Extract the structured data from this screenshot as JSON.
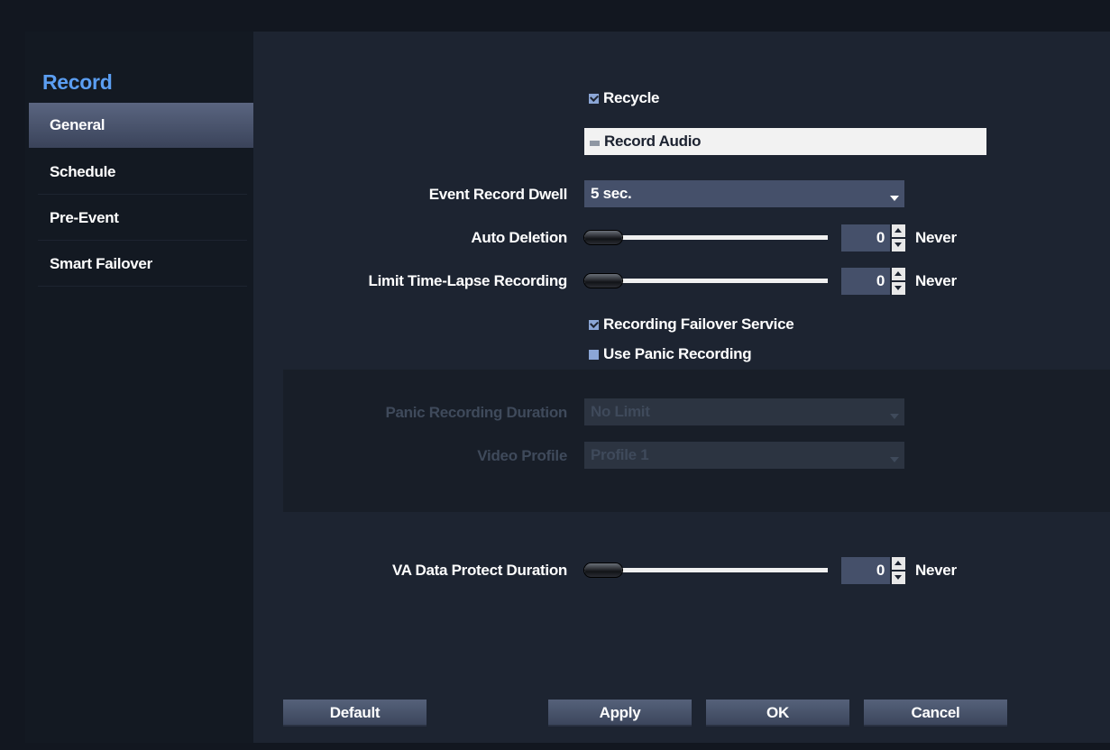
{
  "sidebar": {
    "title": "Record",
    "items": [
      {
        "label": "General"
      },
      {
        "label": "Schedule"
      },
      {
        "label": "Pre-Event"
      },
      {
        "label": "Smart Failover"
      }
    ]
  },
  "general": {
    "recycle": {
      "label": "Recycle",
      "checked": true
    },
    "record_audio": {
      "label": "Record Audio",
      "checked": false
    },
    "event_record_dwell": {
      "label": "Event Record Dwell",
      "value": "5 sec."
    },
    "auto_deletion": {
      "label": "Auto Deletion",
      "value": "0",
      "unit": "Never",
      "slider_fraction": 0
    },
    "limit_time_lapse": {
      "label": "Limit Time-Lapse Recording",
      "value": "0",
      "unit": "Never",
      "slider_fraction": 0
    },
    "recording_failover": {
      "label": "Recording Failover Service",
      "checked": true
    },
    "use_panic": {
      "label": "Use Panic Recording",
      "checked": false
    },
    "panic_duration": {
      "label": "Panic Recording Duration",
      "value": "No Limit",
      "enabled": false
    },
    "video_profile": {
      "label": "Video Profile",
      "value": "Profile 1",
      "enabled": false
    },
    "va_data_protect": {
      "label": "VA Data Protect Duration",
      "value": "0",
      "unit": "Never",
      "slider_fraction": 0
    }
  },
  "buttons": {
    "default": "Default",
    "apply": "Apply",
    "ok": "OK",
    "cancel": "Cancel"
  },
  "colors": {
    "accent": "#5b9ef2",
    "background": "#1d2431",
    "control": "#45506a"
  }
}
